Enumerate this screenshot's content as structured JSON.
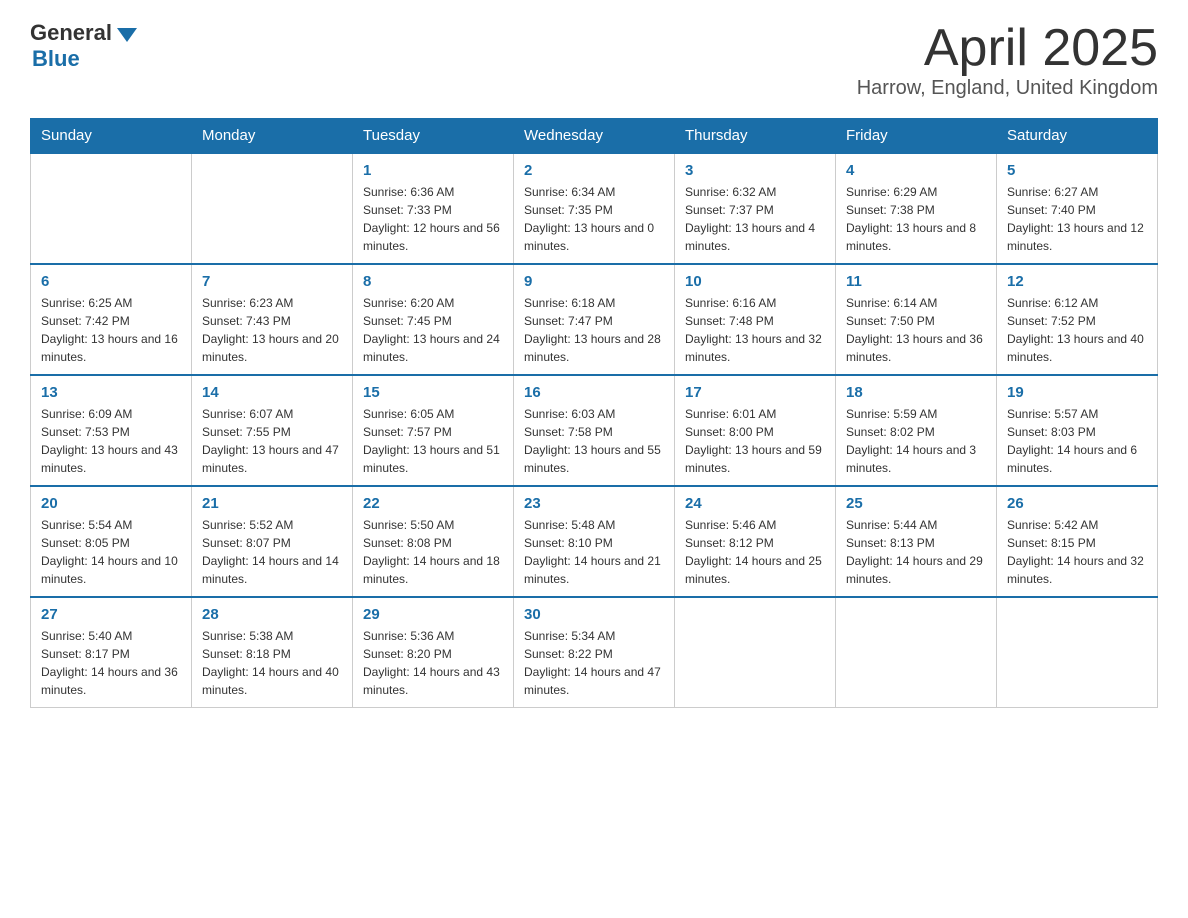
{
  "header": {
    "logo": {
      "top": "General",
      "bottom": "Blue"
    },
    "title": "April 2025",
    "subtitle": "Harrow, England, United Kingdom"
  },
  "weekdays": [
    "Sunday",
    "Monday",
    "Tuesday",
    "Wednesday",
    "Thursday",
    "Friday",
    "Saturday"
  ],
  "weeks": [
    [
      null,
      null,
      {
        "day": "1",
        "sunrise": "Sunrise: 6:36 AM",
        "sunset": "Sunset: 7:33 PM",
        "daylight": "Daylight: 12 hours and 56 minutes."
      },
      {
        "day": "2",
        "sunrise": "Sunrise: 6:34 AM",
        "sunset": "Sunset: 7:35 PM",
        "daylight": "Daylight: 13 hours and 0 minutes."
      },
      {
        "day": "3",
        "sunrise": "Sunrise: 6:32 AM",
        "sunset": "Sunset: 7:37 PM",
        "daylight": "Daylight: 13 hours and 4 minutes."
      },
      {
        "day": "4",
        "sunrise": "Sunrise: 6:29 AM",
        "sunset": "Sunset: 7:38 PM",
        "daylight": "Daylight: 13 hours and 8 minutes."
      },
      {
        "day": "5",
        "sunrise": "Sunrise: 6:27 AM",
        "sunset": "Sunset: 7:40 PM",
        "daylight": "Daylight: 13 hours and 12 minutes."
      }
    ],
    [
      {
        "day": "6",
        "sunrise": "Sunrise: 6:25 AM",
        "sunset": "Sunset: 7:42 PM",
        "daylight": "Daylight: 13 hours and 16 minutes."
      },
      {
        "day": "7",
        "sunrise": "Sunrise: 6:23 AM",
        "sunset": "Sunset: 7:43 PM",
        "daylight": "Daylight: 13 hours and 20 minutes."
      },
      {
        "day": "8",
        "sunrise": "Sunrise: 6:20 AM",
        "sunset": "Sunset: 7:45 PM",
        "daylight": "Daylight: 13 hours and 24 minutes."
      },
      {
        "day": "9",
        "sunrise": "Sunrise: 6:18 AM",
        "sunset": "Sunset: 7:47 PM",
        "daylight": "Daylight: 13 hours and 28 minutes."
      },
      {
        "day": "10",
        "sunrise": "Sunrise: 6:16 AM",
        "sunset": "Sunset: 7:48 PM",
        "daylight": "Daylight: 13 hours and 32 minutes."
      },
      {
        "day": "11",
        "sunrise": "Sunrise: 6:14 AM",
        "sunset": "Sunset: 7:50 PM",
        "daylight": "Daylight: 13 hours and 36 minutes."
      },
      {
        "day": "12",
        "sunrise": "Sunrise: 6:12 AM",
        "sunset": "Sunset: 7:52 PM",
        "daylight": "Daylight: 13 hours and 40 minutes."
      }
    ],
    [
      {
        "day": "13",
        "sunrise": "Sunrise: 6:09 AM",
        "sunset": "Sunset: 7:53 PM",
        "daylight": "Daylight: 13 hours and 43 minutes."
      },
      {
        "day": "14",
        "sunrise": "Sunrise: 6:07 AM",
        "sunset": "Sunset: 7:55 PM",
        "daylight": "Daylight: 13 hours and 47 minutes."
      },
      {
        "day": "15",
        "sunrise": "Sunrise: 6:05 AM",
        "sunset": "Sunset: 7:57 PM",
        "daylight": "Daylight: 13 hours and 51 minutes."
      },
      {
        "day": "16",
        "sunrise": "Sunrise: 6:03 AM",
        "sunset": "Sunset: 7:58 PM",
        "daylight": "Daylight: 13 hours and 55 minutes."
      },
      {
        "day": "17",
        "sunrise": "Sunrise: 6:01 AM",
        "sunset": "Sunset: 8:00 PM",
        "daylight": "Daylight: 13 hours and 59 minutes."
      },
      {
        "day": "18",
        "sunrise": "Sunrise: 5:59 AM",
        "sunset": "Sunset: 8:02 PM",
        "daylight": "Daylight: 14 hours and 3 minutes."
      },
      {
        "day": "19",
        "sunrise": "Sunrise: 5:57 AM",
        "sunset": "Sunset: 8:03 PM",
        "daylight": "Daylight: 14 hours and 6 minutes."
      }
    ],
    [
      {
        "day": "20",
        "sunrise": "Sunrise: 5:54 AM",
        "sunset": "Sunset: 8:05 PM",
        "daylight": "Daylight: 14 hours and 10 minutes."
      },
      {
        "day": "21",
        "sunrise": "Sunrise: 5:52 AM",
        "sunset": "Sunset: 8:07 PM",
        "daylight": "Daylight: 14 hours and 14 minutes."
      },
      {
        "day": "22",
        "sunrise": "Sunrise: 5:50 AM",
        "sunset": "Sunset: 8:08 PM",
        "daylight": "Daylight: 14 hours and 18 minutes."
      },
      {
        "day": "23",
        "sunrise": "Sunrise: 5:48 AM",
        "sunset": "Sunset: 8:10 PM",
        "daylight": "Daylight: 14 hours and 21 minutes."
      },
      {
        "day": "24",
        "sunrise": "Sunrise: 5:46 AM",
        "sunset": "Sunset: 8:12 PM",
        "daylight": "Daylight: 14 hours and 25 minutes."
      },
      {
        "day": "25",
        "sunrise": "Sunrise: 5:44 AM",
        "sunset": "Sunset: 8:13 PM",
        "daylight": "Daylight: 14 hours and 29 minutes."
      },
      {
        "day": "26",
        "sunrise": "Sunrise: 5:42 AM",
        "sunset": "Sunset: 8:15 PM",
        "daylight": "Daylight: 14 hours and 32 minutes."
      }
    ],
    [
      {
        "day": "27",
        "sunrise": "Sunrise: 5:40 AM",
        "sunset": "Sunset: 8:17 PM",
        "daylight": "Daylight: 14 hours and 36 minutes."
      },
      {
        "day": "28",
        "sunrise": "Sunrise: 5:38 AM",
        "sunset": "Sunset: 8:18 PM",
        "daylight": "Daylight: 14 hours and 40 minutes."
      },
      {
        "day": "29",
        "sunrise": "Sunrise: 5:36 AM",
        "sunset": "Sunset: 8:20 PM",
        "daylight": "Daylight: 14 hours and 43 minutes."
      },
      {
        "day": "30",
        "sunrise": "Sunrise: 5:34 AM",
        "sunset": "Sunset: 8:22 PM",
        "daylight": "Daylight: 14 hours and 47 minutes."
      },
      null,
      null,
      null
    ]
  ]
}
